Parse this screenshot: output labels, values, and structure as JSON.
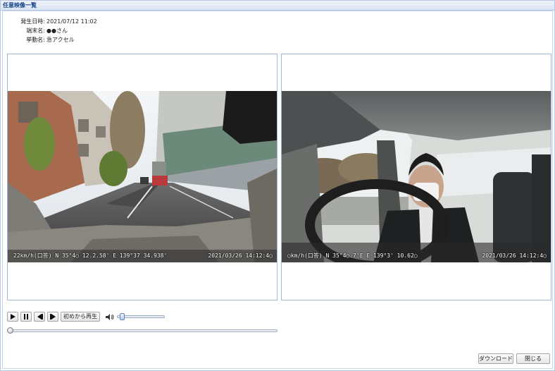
{
  "window": {
    "title": "任意映像一覧"
  },
  "info": {
    "occurred_label": "発生日時:",
    "occurred_value": "2021/07/12 11:02",
    "terminal_label": "端末名:",
    "terminal_value": "●●さん",
    "behavior_label": "挙動名:",
    "behavior_value": "急アクセル"
  },
  "videos": [
    {
      "name": "front-camera",
      "osd_left": "22km/h(口答)  N 35°4○ 12.2.58'  E 139°37 34.938'",
      "osd_right": "2021/03/26 14:12:4○"
    },
    {
      "name": "cabin-camera",
      "osd_left": "○km/h(口答)  N 35°4○.7'E E 139°3' 10.62○",
      "osd_right": "2021/03/26 14:12:4○"
    }
  ],
  "controls": {
    "play_icon": "play-icon",
    "pause_icon": "pause-icon",
    "step_back_icon": "step-back-icon",
    "step_forward_icon": "step-forward-icon",
    "restart_label": "初めから再生",
    "volume_icon": "speaker-icon",
    "volume_level": 0.05,
    "seek_position": 0.0
  },
  "footer": {
    "download_label": "ダウンロード",
    "close_label": "閉じる"
  }
}
